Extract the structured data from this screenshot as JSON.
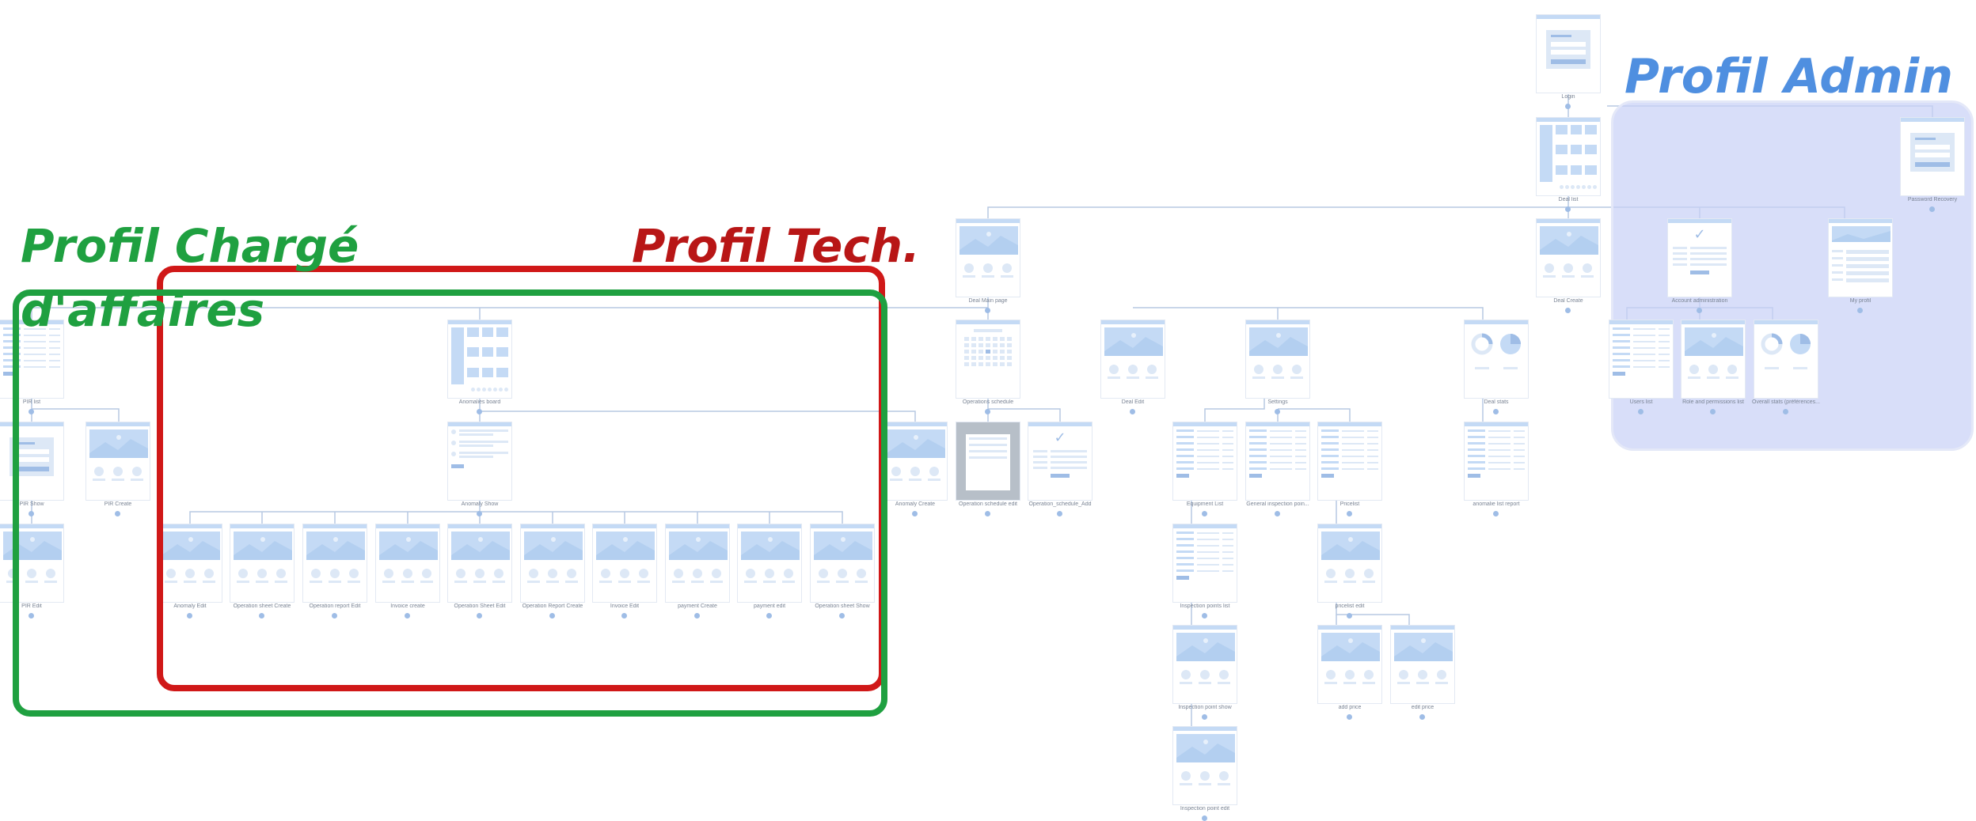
{
  "profiles": {
    "admin": {
      "title": "Profil Admin",
      "color": "#4f8fe0",
      "fill": "#d6dcf7"
    },
    "tech": {
      "title": "Profil Tech.",
      "color": "#d01818"
    },
    "charge": {
      "title_line1": "Profil Chargé",
      "title_line2": "d'affaires",
      "color": "#1fa040"
    }
  },
  "colors": {
    "connector": "#b7c9e2",
    "card_accent": "#c4daf5",
    "dot": "#9fbde6"
  },
  "screens": {
    "login": "Login",
    "deal_list": "Deal list",
    "password_recovery": "Password Recovery",
    "deal_main_page": "Deal Main page",
    "deal_create": "Deal Create",
    "account_administration": "Account administration",
    "my_profil": "My profil",
    "pir_list": "PIR list",
    "anomalies_board": "Anomalies board",
    "operations_schedule": "Operations schedule",
    "deal_edit": "Deal Edit",
    "settings": "Settings",
    "deal_stats": "Deal stats",
    "users_list": "Users list",
    "role_permissions_list": "Role and permissions list",
    "overall_stats": "Overall stats (préférences...",
    "pir_show": "PIR Show",
    "pir_create": "PIR Create",
    "anomaly_show": "Anomaly Show",
    "anomaly_create": "Anomaly Create",
    "operation_schedule_edit": "Operation schedule edit",
    "operation_schedule_add": "Operation_schedule_Add",
    "equipment_list": "Equipment List",
    "general_inspection_points": "General inspection poin...",
    "pricelist": "Pricelist",
    "anomalie_list_report": "anomalie list report",
    "pir_edit": "PIR Edit",
    "anomaly_edit": "Anomaly Edit",
    "operation_sheet_create": "Operation sheet Create",
    "operation_report_edit": "Operation report Edit",
    "invoice_create": "Invoice create",
    "operation_sheet_edit": "Operation Sheet Edit",
    "operation_report_create": "Operation Report Create",
    "invoice_edit": "Invoice Edit",
    "payment_create": "payment Create",
    "payment_edit": "payment edit",
    "operation_sheet_show": "Operation sheet Show",
    "inspection_points_list": "Inspection points list",
    "pricelist_edit": "pricelist edit",
    "inspection_point_show": "Inspection point show",
    "add_price": "add price",
    "edit_price": "edit price",
    "inspection_point_edit": "Inspection point edit"
  }
}
